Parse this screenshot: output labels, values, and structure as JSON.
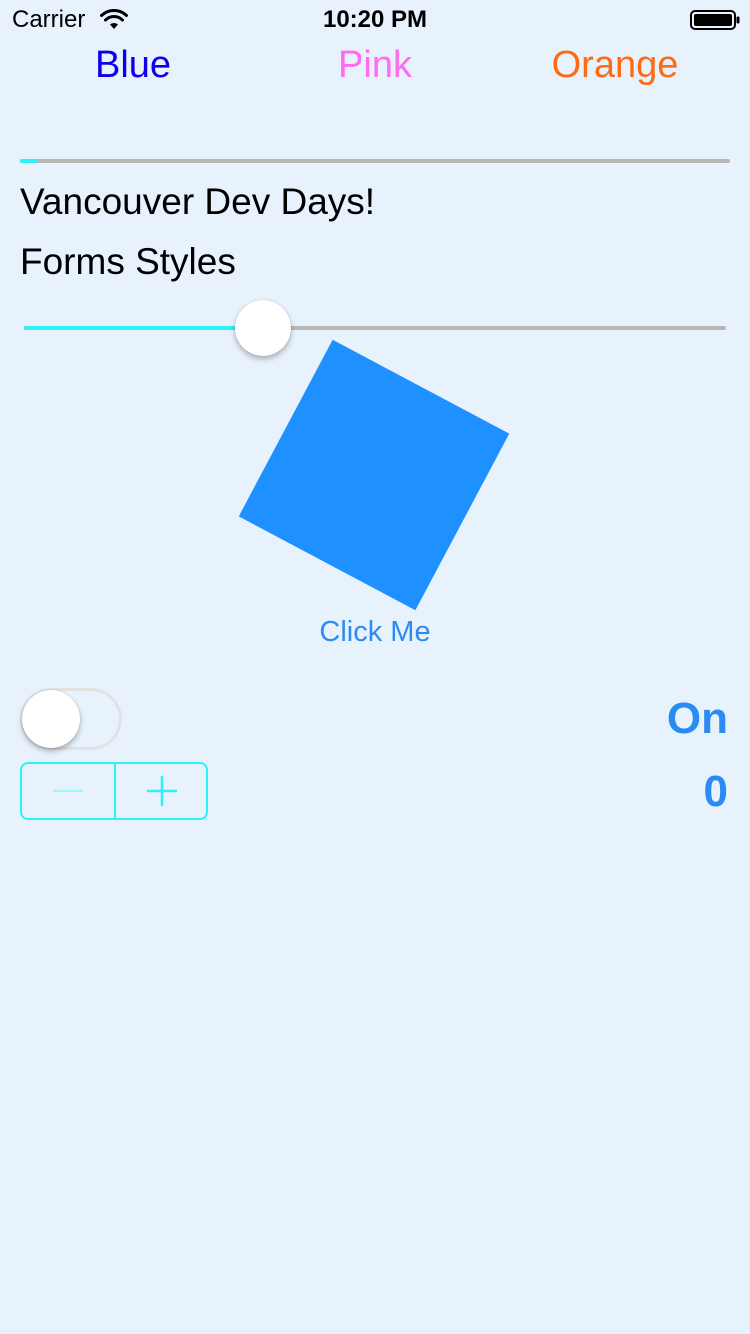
{
  "status_bar": {
    "carrier": "Carrier",
    "time": "10:20 PM"
  },
  "color_tabs": [
    {
      "label": "Blue",
      "color": "#0d00f0"
    },
    {
      "label": "Pink",
      "color": "#ff6cf2"
    },
    {
      "label": "Orange",
      "color": "#ff6a14"
    }
  ],
  "progress": {
    "value": 0.025
  },
  "labels": {
    "line1": "Vancouver Dev Days!",
    "line2": "Forms Styles"
  },
  "slider": {
    "value": 0.34
  },
  "box": {
    "color": "#1e90ff",
    "rotation_degrees": 28
  },
  "button": {
    "label": "Click Me"
  },
  "switch": {
    "is_on": false,
    "status_label": "On"
  },
  "stepper": {
    "value": "0"
  },
  "theme": {
    "background": "#e8f2fd",
    "accent": "#2ff0f6",
    "label_blue": "#2a8cf2"
  }
}
